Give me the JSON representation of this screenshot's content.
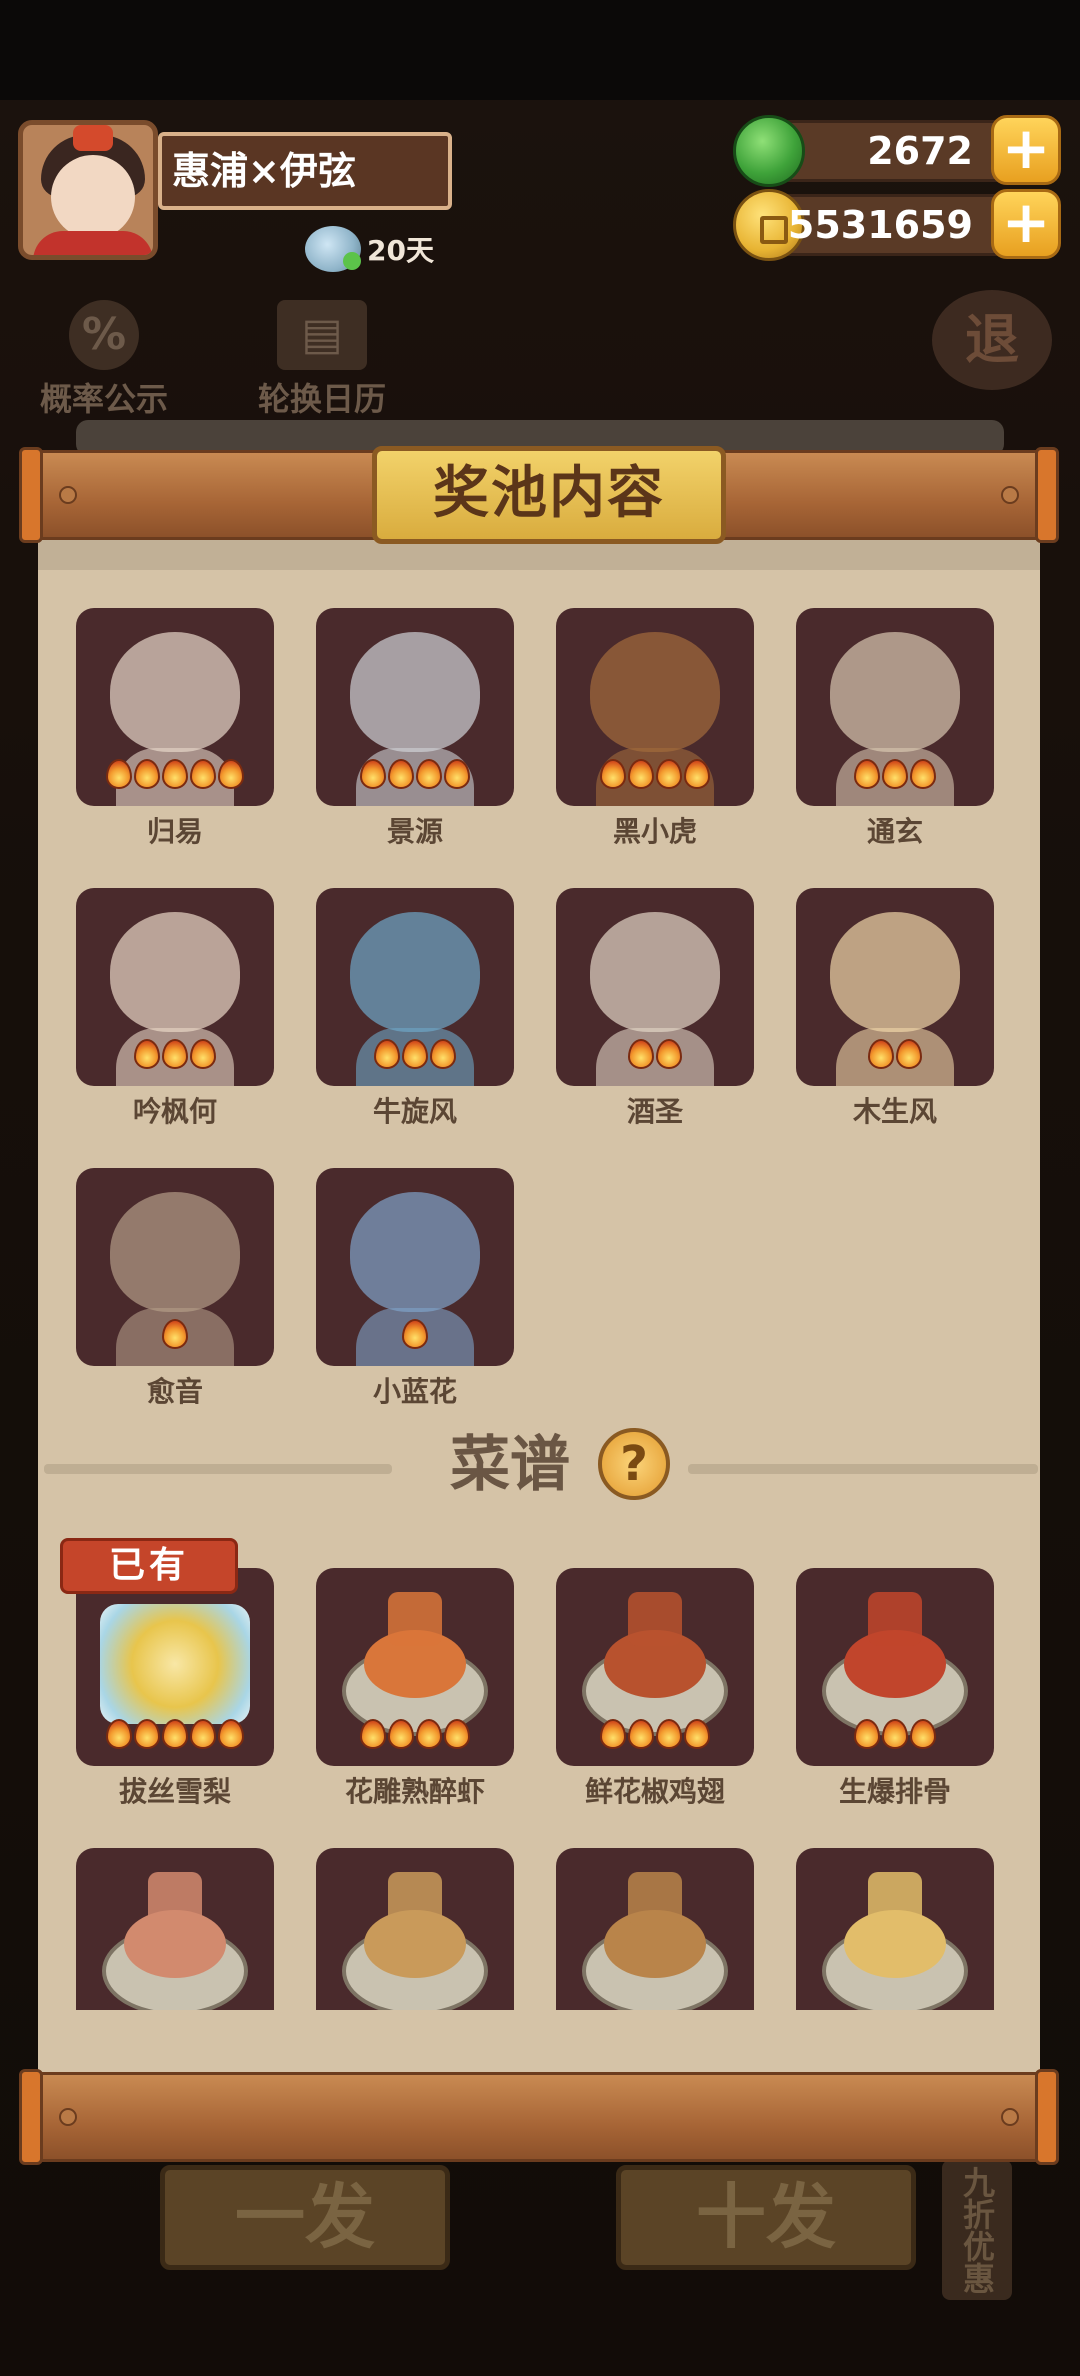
{
  "user": {
    "name": "惠浦×伊弦",
    "days": "20天"
  },
  "currency": {
    "jade": "2672",
    "coins": "5531659"
  },
  "shortcuts": [
    {
      "label": "概率公示",
      "icon": "percent-icon"
    },
    {
      "label": "轮换日历",
      "icon": "calendar-icon"
    }
  ],
  "exit_label": "退",
  "buttons": {
    "single": "一发",
    "ten": "十发",
    "discount": "九折优惠"
  },
  "panel": {
    "title": "奖池内容"
  },
  "characters": [
    {
      "name": "归易",
      "stars": 5,
      "color": "#e7d7c9"
    },
    {
      "name": "景源",
      "stars": 4,
      "color": "#cfd2d6"
    },
    {
      "name": "黑小虎",
      "stars": 4,
      "color": "#a26b3c"
    },
    {
      "name": "通玄",
      "stars": 3,
      "color": "#d8c7b0"
    },
    {
      "name": "吟枫何",
      "stars": 3,
      "color": "#e9d7c6"
    },
    {
      "name": "牛旋风",
      "stars": 3,
      "color": "#6ea6c7"
    },
    {
      "name": "酒圣",
      "stars": 2,
      "color": "#e2d5c6"
    },
    {
      "name": "木生风",
      "stars": 2,
      "color": "#f0d6a8"
    },
    {
      "name": "愈音",
      "stars": 1,
      "color": "#b49d88"
    },
    {
      "name": "小蓝花",
      "stars": 1,
      "color": "#7fa3c9"
    }
  ],
  "recipes_section": {
    "title": "菜谱",
    "help_icon": "?"
  },
  "owned_badge": "已有",
  "recipes": [
    {
      "name": "拔丝雪梨",
      "stars": 5,
      "color": "#f0cc5a",
      "owned": true
    },
    {
      "name": "花雕熟醉虾",
      "stars": 4,
      "color": "#d9763a",
      "owned": false
    },
    {
      "name": "鲜花椒鸡翅",
      "stars": 4,
      "color": "#b8522e",
      "owned": false
    },
    {
      "name": "生爆排骨",
      "stars": 3,
      "color": "#c1452c",
      "owned": false
    },
    {
      "name": "",
      "stars": 0,
      "color": "#d28a6e",
      "owned": false
    },
    {
      "name": "",
      "stars": 0,
      "color": "#c99a5a",
      "owned": false
    },
    {
      "name": "",
      "stars": 0,
      "color": "#b9844a",
      "owned": false
    },
    {
      "name": "",
      "stars": 0,
      "color": "#e2bd6a",
      "owned": false
    }
  ]
}
